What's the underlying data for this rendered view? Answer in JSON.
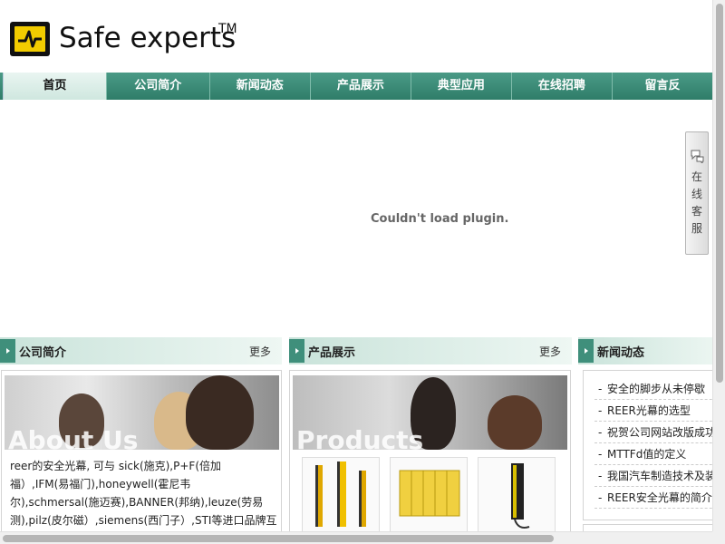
{
  "header": {
    "site_title": "Safe experts",
    "trademark": "TM"
  },
  "nav": {
    "items": [
      {
        "label": "首页",
        "active": true
      },
      {
        "label": "公司简介"
      },
      {
        "label": "新闻动态"
      },
      {
        "label": "产品展示"
      },
      {
        "label": "典型应用"
      },
      {
        "label": "在线招聘"
      },
      {
        "label": "留言反"
      }
    ]
  },
  "plugin": {
    "message": "Couldn't load plugin."
  },
  "service": {
    "label_chars": [
      "在",
      "线",
      "客",
      "服"
    ],
    "icon": "chat-bubble-icon"
  },
  "about": {
    "title": "公司简介",
    "more": "更多",
    "banner_text": "About Us",
    "text": "reer的安全光幕, 可与 sick(施克),P+F(倍加福）,IFM(易福门),honeywell(霍尼韦尔),schmersal(施迈赛),BANNER(邦纳),leuze(劳易测),pilz(皮尔磁）,siemens(西门子）,STI等进口品牌互换；意大利原"
  },
  "products": {
    "title": "产品展示",
    "more": "更多",
    "banner_text": "Products"
  },
  "news": {
    "title": "新闻动态",
    "items": [
      "安全的脚步从未停歇",
      "REER光幕的选型",
      "祝贺公司网站改版成功",
      "MTTFd值的定义",
      "我国汽车制造技术及装备",
      "REER安全光幕的简介"
    ]
  },
  "colors": {
    "nav_green": "#2f7d69",
    "logo_yellow": "#f2cc00"
  }
}
